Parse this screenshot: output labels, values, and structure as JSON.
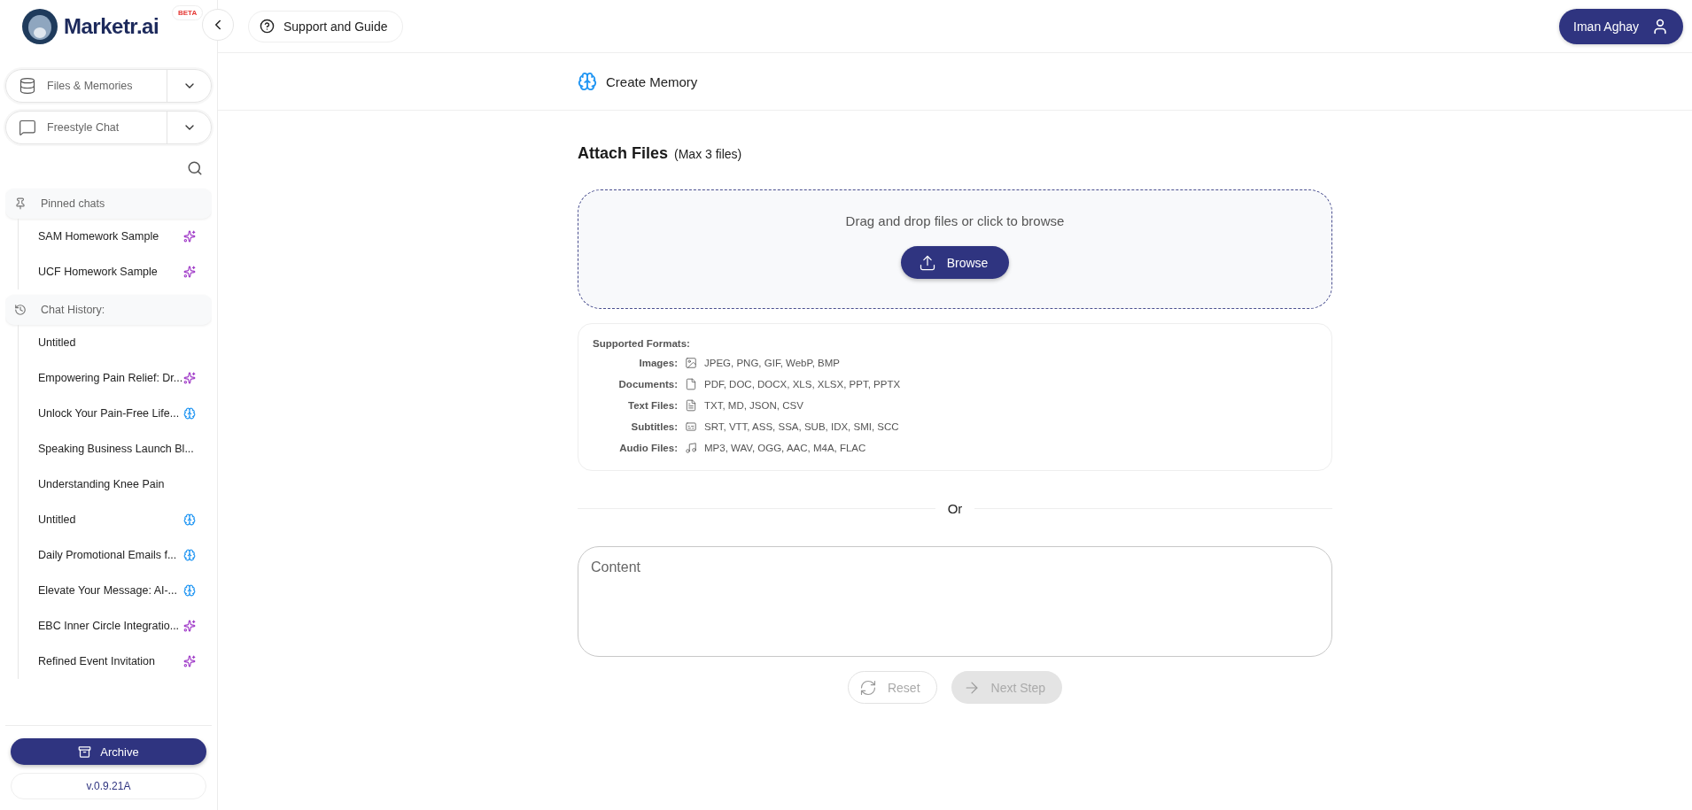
{
  "sidebar": {
    "logo": {
      "text": "Marketr.ai",
      "badge": "BETA"
    },
    "nav": [
      {
        "label": "Files & Memories",
        "kind": "database",
        "expanded": false
      },
      {
        "label": "Freestyle Chat",
        "kind": "chat",
        "expanded": false
      }
    ],
    "pinned": {
      "title": "Pinned chats",
      "items": [
        {
          "label": "SAM Homework Sample",
          "kind": "sparkle"
        },
        {
          "label": "UCF Homework Sample",
          "kind": "sparkle"
        }
      ]
    },
    "history": {
      "title": "Chat History:",
      "items": [
        {
          "label": "Untitled",
          "kind": "plain"
        },
        {
          "label": "Empowering Pain Relief: Dr...",
          "kind": "sparkle"
        },
        {
          "label": "Unlock Your Pain-Free Life...",
          "kind": "brain"
        },
        {
          "label": "Speaking Business Launch Bl...",
          "kind": "plain"
        },
        {
          "label": "Understanding Knee Pain",
          "kind": "plain"
        },
        {
          "label": "Untitled",
          "kind": "brain"
        },
        {
          "label": "Daily Promotional Emails f...",
          "kind": "brain"
        },
        {
          "label": "Elevate Your Message: AI-...",
          "kind": "brain"
        },
        {
          "label": "EBC Inner Circle Integratio...",
          "kind": "sparkle"
        },
        {
          "label": "Refined Event Invitation",
          "kind": "sparkle"
        }
      ]
    },
    "archive_button": "Archive",
    "version": "v.0.9.21A"
  },
  "topbar": {
    "support": "Support and Guide",
    "user": "Iman Aghay"
  },
  "page": {
    "title": "Create Memory",
    "attach": {
      "title": "Attach Files",
      "note": "(Max 3 files)"
    },
    "dropzone": {
      "text": "Drag and drop files or click to browse",
      "button": "Browse"
    },
    "formats": {
      "title": "Supported Formats:",
      "rows": [
        {
          "label": "Images:",
          "kind": "image",
          "value": "JPEG, PNG, GIF, WebP, BMP"
        },
        {
          "label": "Documents:",
          "kind": "document",
          "value": "PDF, DOC, DOCX, XLS, XLSX, PPT, PPTX"
        },
        {
          "label": "Text Files:",
          "kind": "text",
          "value": "TXT, MD, JSON, CSV"
        },
        {
          "label": "Subtitles:",
          "kind": "subtitle",
          "value": "SRT, VTT, ASS, SSA, SUB, IDX, SMI, SCC"
        },
        {
          "label": "Audio Files:",
          "kind": "audio",
          "value": "MP3, WAV, OGG, AAC, M4A, FLAC"
        }
      ]
    },
    "divider": "Or",
    "content": {
      "placeholder": "Content"
    },
    "actions": [
      {
        "label": "Reset",
        "kind": "reset",
        "disabled": true
      },
      {
        "label": "Next Step",
        "kind": "next",
        "disabled": true
      }
    ]
  }
}
